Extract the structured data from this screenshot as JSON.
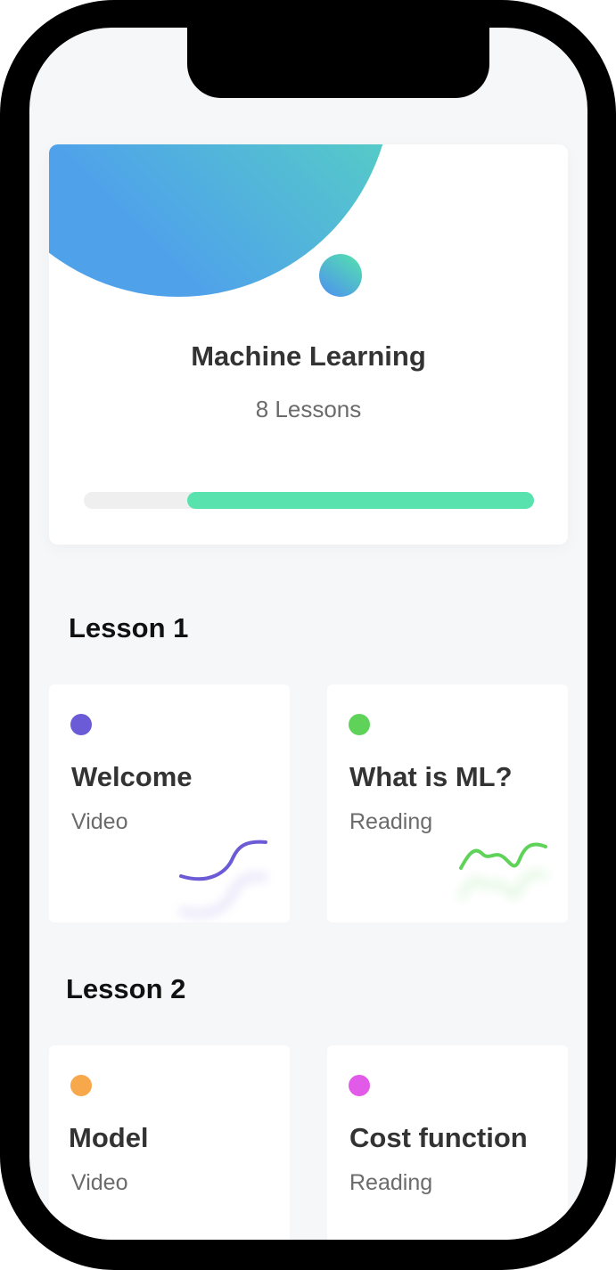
{
  "course": {
    "title": "Machine Learning",
    "lessons_count": "8 Lessons",
    "progress_fraction": 0.77,
    "accent_color": "#58e2ae"
  },
  "sections": [
    {
      "heading": "Lesson 1",
      "items": [
        {
          "title": "Welcome",
          "type": "Video",
          "dot_color": "#6b5bd6",
          "icon": "purple-curve-icon"
        },
        {
          "title": "What is ML?",
          "type": "Reading",
          "dot_color": "#5fd25a",
          "icon": "green-wave-icon"
        }
      ]
    },
    {
      "heading": "Lesson 2",
      "items": [
        {
          "title": "Model",
          "type": "Video",
          "dot_color": "#f6a84a"
        },
        {
          "title": "Cost function",
          "type": "Reading",
          "dot_color": "#e15ae8"
        }
      ]
    }
  ]
}
